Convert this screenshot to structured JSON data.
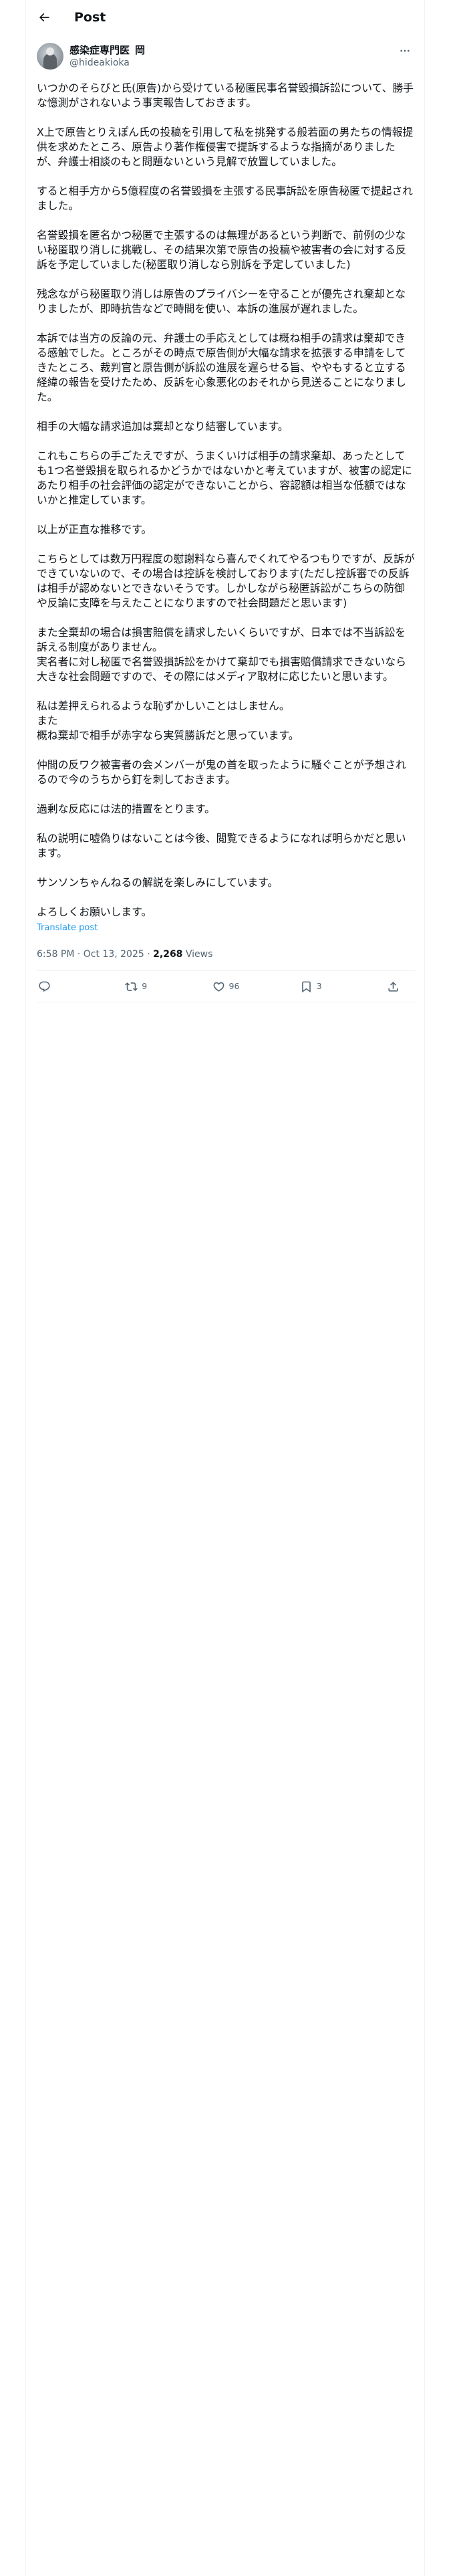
{
  "header": {
    "title": "Post"
  },
  "author": {
    "display_name": "感染症専門医",
    "badge_text": "岡",
    "handle": "@hideakioka"
  },
  "post": {
    "paragraphs": [
      "いつかのそらびと氏(原告)から受けている秘匿民事名誉毀損訴訟について、勝手な憶測がされないよう事実報告しておきます。",
      "X上で原告とりえぽん氏の投稿を引用して私を挑発する般若面の男たちの情報提供を求めたところ、原告より著作権侵害で提訴するような指摘がありましたが、弁護士相談のもと問題ないという見解で放置していました。",
      "すると相手方から5億程度の名誉毀損を主張する民事訴訟を原告秘匿で提起されました。",
      "名誉毀損を匿名かつ秘匿で主張するのは無理があるという判断で、前例の少ない秘匿取り消しに挑戦し、その結果次第で原告の投稿や被害者の会に対する反訴を予定していました(秘匿取り消しなら別訴を予定していました)",
      "残念ながら秘匿取り消しは原告のプライバシーを守ることが優先され棄却となりましたが、即時抗告などで時間を使い、本訴の進展が遅れました。",
      "本訴では当方の反論の元、弁護士の手応えとしては概ね相手の請求は棄却できる感触でした。ところがその時点で原告側が大幅な請求を拡張する申請をしてきたところ、裁判官と原告側が訴訟の進展を遅らせる旨、ややもすると立する経緯の報告を受けたため、反訴を心象悪化のおそれから見送ることになりました。",
      "相手の大幅な請求追加は棄却となり結審しています。",
      "これもこちらの手ごたえですが、うまくいけば相手の請求棄却、あったとしても1つ名誉毀損を取られるかどうかではないかと考えていますが、被害の認定にあたり相手の社会評価の認定ができないことから、容認額は相当な低額ではないかと推定しています。",
      "以上が正直な推移です。",
      "こちらとしては数万円程度の慰謝料なら喜んでくれてやるつもりですが、反訴ができていないので、その場合は控訴を検討しております(ただし控訴審での反訴は相手が認めないとできないそうです。しかしながら秘匿訴訟がこちらの防御や反論に支障を与えたことになりますので社会問題だと思います)",
      "また全棄却の場合は損害賠償を請求したいくらいですが、日本では不当訴訟を訴える制度がありません。\n実名者に対し秘匿で名誉毀損訴訟をかけて棄却でも損害賠償請求できないなら大きな社会問題ですので、その際にはメディア取材に応じたいと思います。",
      "私は差押えられるような恥ずかしいことはしません。\nまた\n概ね棄却で相手が赤字なら実質勝訴だと思っています。",
      "仲間の反ワク被害者の会メンバーが鬼の首を取ったように騒ぐことが予想されるので今のうちから釘を刺しておきます。",
      "過剰な反応には法的措置をとります。",
      "私の説明に嘘偽りはないことは今後、閲覧できるようになれば明らかだと思います。",
      "サンソンちゃんねるの解説を楽しみにしています。",
      "よろしくお願いします。"
    ],
    "translate_label": "Translate post",
    "time": "6:58 PM",
    "date": "Oct 13, 2025",
    "separator": "·",
    "views_count": "2,268",
    "views_label": "Views"
  },
  "actions": {
    "reply_count": "",
    "repost_count": "9",
    "like_count": "96",
    "bookmark_count": "3"
  },
  "colors": {
    "text": "#0f1419",
    "secondary": "#536471",
    "link": "#1d9bf0",
    "border": "#eff3f4"
  }
}
